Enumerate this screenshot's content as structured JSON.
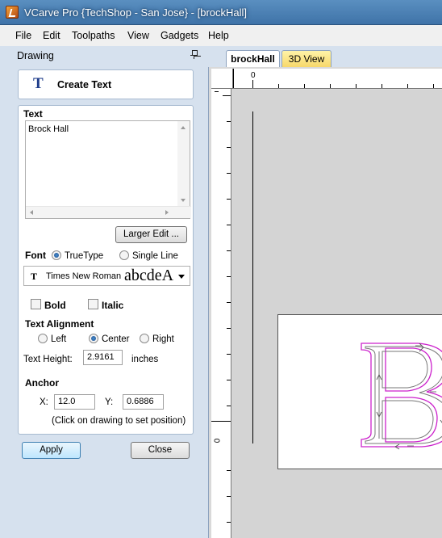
{
  "window": {
    "title": "VCarve Pro {TechShop - San Jose} - [brockHall]"
  },
  "menu": [
    "File",
    "Edit",
    "Toolpaths",
    "View",
    "Gadgets",
    "Help"
  ],
  "pane": {
    "title": "Drawing",
    "heading": "Create Text",
    "text_section": "Text",
    "text_value": "Brock Hall",
    "larger_edit_label": "Larger Edit ...",
    "font_label": "Font",
    "font_options": [
      "TrueType",
      "Single Line"
    ],
    "font_selected": "TrueType",
    "font_name": "Times New Roman",
    "font_preview": "abcdeA",
    "bold_label": "Bold",
    "italic_label": "Italic",
    "bold_checked": false,
    "italic_checked": false,
    "alignment_label": "Text Alignment",
    "alignment_options": [
      "Left",
      "Center",
      "Right"
    ],
    "alignment_selected": "Center",
    "text_height_label": "Text Height:",
    "text_height_value": "2.9161",
    "text_height_unit": "inches",
    "anchor_label": "Anchor",
    "anchor_x_label": "X:",
    "anchor_x_value": "12.0",
    "anchor_y_label": "Y:",
    "anchor_y_value": "0.6886",
    "anchor_hint": "(Click on drawing to set position)",
    "apply_label": "Apply",
    "close_label": "Close"
  },
  "tabs": [
    {
      "label": "brockHall",
      "active": true
    },
    {
      "label": "3D View",
      "active": false
    }
  ],
  "rulers": {
    "top_zero": "0",
    "left_zero": "0"
  },
  "colors": {
    "vector_outline": "#cc22cc",
    "toolpath": "#666666",
    "accent": "#3f73a8"
  }
}
